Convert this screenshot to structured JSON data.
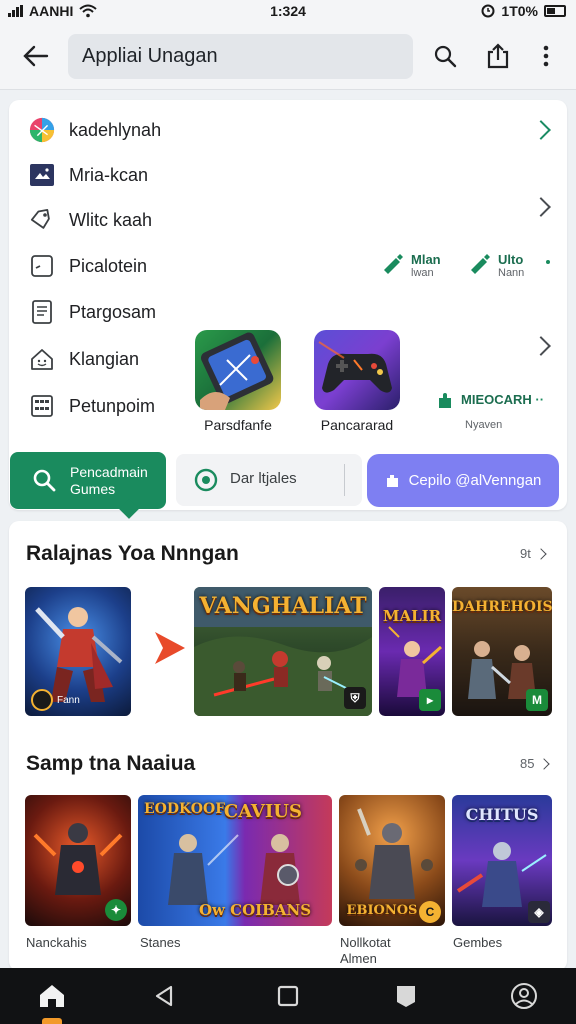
{
  "status_bar": {
    "carrier": "AANHI",
    "time": "1:324",
    "battery": "1T0%"
  },
  "header": {
    "title": "Appliai Unagan"
  },
  "menu": {
    "items": [
      {
        "label": "kadehlynah",
        "icon": "colorful-app-icon"
      },
      {
        "label": "Mria-kcan",
        "icon": "image-icon"
      },
      {
        "label": "Wlitc kaah",
        "icon": "tag-icon"
      },
      {
        "label": "Picalotein",
        "icon": "photo-frame-icon"
      },
      {
        "label": "Ptargosam",
        "icon": "document-icon"
      },
      {
        "label": "Klangian",
        "icon": "home-icon"
      },
      {
        "label": "Petunpoim",
        "icon": "grid-icon"
      }
    ]
  },
  "promos": {
    "first": {
      "title": "Mlan",
      "sub": "lwan"
    },
    "second": {
      "title": "Ulto",
      "sub": "Nann"
    },
    "third": {
      "title": "MIEOCARH",
      "sub": "Nyaven"
    }
  },
  "featured_tiles": [
    {
      "label": "Parsdfanfe"
    },
    {
      "label": "Pancararad"
    }
  ],
  "filters": {
    "primary": {
      "line1": "Pencadmain",
      "line2": "Gumes"
    },
    "secondary": "Dar ltjales",
    "action": "Cepilo @alVenngan"
  },
  "section1": {
    "title": "Ralajnas Yoa Nnngan",
    "more": "9t",
    "thumbs": [
      {
        "badge_text": "Fann"
      },
      {
        "art_title": "VANGHALIAT"
      },
      {
        "art_title": "MALIR"
      },
      {
        "art_title": "DAHREHOIS"
      }
    ]
  },
  "section2": {
    "title": "Samp tna Naaiua",
    "more": "85",
    "thumbs": [
      {
        "caption": "Nanckahis"
      },
      {
        "caption": "Stanes",
        "art_title": "EODKOOF",
        "art_title2": "CAVIUS",
        "art_bottom": "Ow COIBANS"
      },
      {
        "caption": "Nollkotat",
        "caption2": "Almen",
        "art_bottom": "EBIONOS"
      },
      {
        "caption": "Gembes",
        "art_title": "CHITUS"
      }
    ]
  }
}
